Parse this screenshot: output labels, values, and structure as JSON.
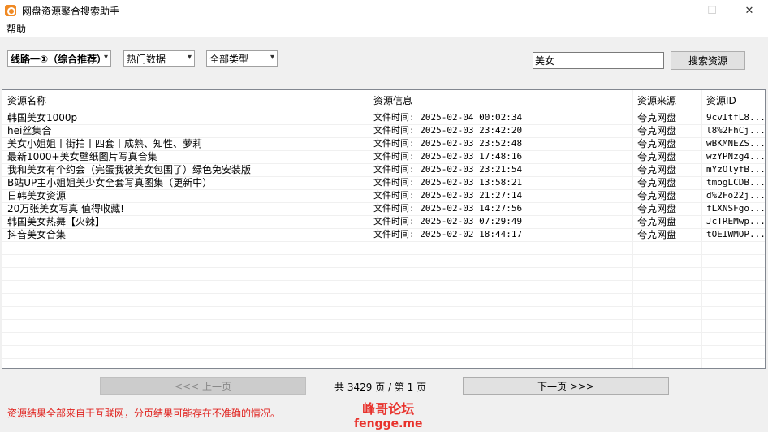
{
  "window": {
    "title": "网盘资源聚合搜索助手",
    "minimize": "—",
    "maximize": "☐",
    "close": "✕"
  },
  "menu": {
    "help": "帮助"
  },
  "toolbar": {
    "route_select": "线路一①（综合推荐）",
    "data_select": "热门数据",
    "type_select": "全部类型",
    "search_value": "美女",
    "search_button": "搜索资源"
  },
  "table": {
    "columns": [
      "资源名称",
      "资源信息",
      "资源来源",
      "资源ID"
    ],
    "rows": [
      {
        "name": "韩国美女1000p",
        "info": "文件时间: 2025-02-04 00:02:34",
        "source": "夸克网盘",
        "id": "9cvItfL8..."
      },
      {
        "name": "hei丝集合",
        "info": "文件时间: 2025-02-03 23:42:20",
        "source": "夸克网盘",
        "id": "l8%2FhCj..."
      },
      {
        "name": "美女小姐姐丨街拍丨四套丨成熟、知性、萝莉",
        "info": "文件时间: 2025-02-03 23:52:48",
        "source": "夸克网盘",
        "id": "wBKMNEZS..."
      },
      {
        "name": "最新1000+美女壁纸图片写真合集",
        "info": "文件时间: 2025-02-03 17:48:16",
        "source": "夸克网盘",
        "id": "wzYPNzg4..."
      },
      {
        "name": "我和美女有个约会（完蛋我被美女包围了）绿色免安装版",
        "info": "文件时间: 2025-02-03 23:21:54",
        "source": "夸克网盘",
        "id": "mYzOlyfB..."
      },
      {
        "name": "B站UP主小姐姐美少女全套写真图集（更新中）",
        "info": "文件时间: 2025-02-03 13:58:21",
        "source": "夸克网盘",
        "id": "tmogLCDB..."
      },
      {
        "name": "日韩美女资源",
        "info": "文件时间: 2025-02-03 21:27:14",
        "source": "夸克网盘",
        "id": "d%2Fo22j..."
      },
      {
        "name": "20万张美女写真 值得收藏!",
        "info": "文件时间: 2025-02-03 14:27:56",
        "source": "夸克网盘",
        "id": "fLXNSFgo..."
      },
      {
        "name": "韩国美女热舞【火辣】",
        "info": "文件时间: 2025-02-03 07:29:49",
        "source": "夸克网盘",
        "id": "JcTREMwp..."
      },
      {
        "name": "抖音美女合集",
        "info": "文件时间: 2025-02-02 18:44:17",
        "source": "夸克网盘",
        "id": "tOEIWMOP..."
      }
    ]
  },
  "pager": {
    "prev": "<<<  上一页",
    "next": "下一页  >>>",
    "info": "共 3429 页 / 第 1 页"
  },
  "footer": {
    "note": "资源结果全部来自于互联网，分页结果可能存在不准确的情况。",
    "watermark_line1": "峰哥论坛",
    "watermark_line2": "fengge.me"
  }
}
